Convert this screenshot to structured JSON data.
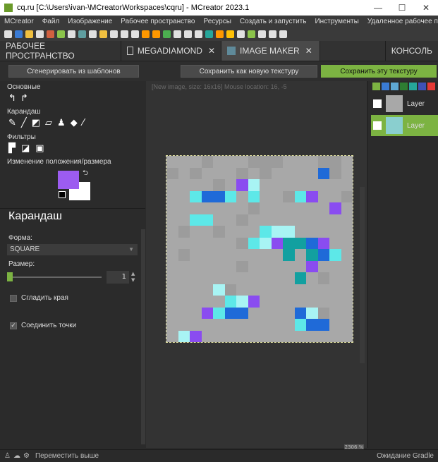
{
  "window": {
    "title": "cq.ru [C:\\Users\\ivan-\\MCreatorWorkspaces\\cqru] - MCreator 2023.1",
    "controls": [
      "—",
      "☐",
      "✕"
    ]
  },
  "menu": [
    "MCreator",
    "Файл",
    "Изображение",
    "Рабочее пространство",
    "Ресурсы",
    "Создать и запустить",
    "Инструменты",
    "Удаленное рабочее простран"
  ],
  "toolbar_colors": [
    "#e0e0e0",
    "#3a7bd5",
    "#f0c040",
    "#e0e0e0",
    "#d06040",
    "#8bc34a",
    "#e0e0e0",
    "#5f9ea0",
    "#e0e0e0",
    "#f0c040",
    "#e0e0e0",
    "#e0e0e0",
    "#e0e0e0",
    "#ff9800",
    "#ff9800",
    "#4caf50",
    "#e0e0e0",
    "#e0e0e0",
    "#e0e0e0",
    "#26a69a",
    "#ff9800",
    "#ffc107",
    "#e0e0e0",
    "#8bc34a",
    "#e0e0e0",
    "#e0e0e0",
    "#e0e0e0"
  ],
  "tabs": {
    "workspace": "РАБОЧЕЕ ПРОСТРАНСТВО",
    "megadiamond": "MEGADIAMOND",
    "image_maker": "IMAGE MAKER",
    "console": "КОНСОЛЬ",
    "close_glyph": "✕"
  },
  "actions": {
    "generate": "Сгенерировать из шаблонов",
    "save_new": "Сохранить как новую текстуру",
    "save_this": "Сохранить эту текстуру"
  },
  "tools": {
    "basic_label": "Основные",
    "pencil_label": "Карандаш",
    "filters_label": "Фильтры",
    "transform_label": "Изменение положения/размера"
  },
  "properties": {
    "title": "Карандаш",
    "shape_label": "Форма:",
    "shape_value": "SQUARE",
    "size_label": "Размер:",
    "size_value": "1",
    "smooth_label": "Сгладить края",
    "smooth_checked": false,
    "connect_label": "Соединить точки",
    "connect_checked": true
  },
  "canvas": {
    "info": "[New image, size: 16x16] Mouse location: 16, -5",
    "zoom": "2306 %",
    "pixels": [
      "aaabaaabbbaaabba",
      "babaaababaaaaDba",
      "aaaabaPMaaaaaaaa",
      "aaCDDCaCaabCPaab",
      "aaaaaaabaaaaaaPa",
      "aaCCaabaaaaaaaaa",
      "abaabaaaCMMaaaaa",
      "aaaaaabCMPTTDPaa",
      "abaaaaaaaaTaTDCa",
      "aaaaaabaaaaaPaaa",
      "aaaaaaaaaaaTabaa",
      "aaaaMbaaaaaaaaaa",
      "aaaaaCMPaaaaaaaa",
      "aaaPCDDaaaaDMbaa",
      "aaaaaaaaaaaCDDaa",
      "aMPaaaaaaaaaaaaa"
    ],
    "palette": {
      "a": "#a8a8a8",
      "b": "#9c9c9c",
      "C": "#5de8e8",
      "M": "#a8f4f4",
      "D": "#1f6ad8",
      "P": "#8a4cf0",
      "T": "#12a0a0"
    }
  },
  "layers": [
    {
      "name": "Layer",
      "selected": false
    },
    {
      "name": "Layer",
      "selected": true
    }
  ],
  "colors": {
    "primary": "#9c5cf0",
    "secondary": "#ffffff",
    "accent": "#7cb342"
  },
  "status": {
    "left_text": "Переместить выше",
    "right_text": "Ожидание Gradle"
  }
}
